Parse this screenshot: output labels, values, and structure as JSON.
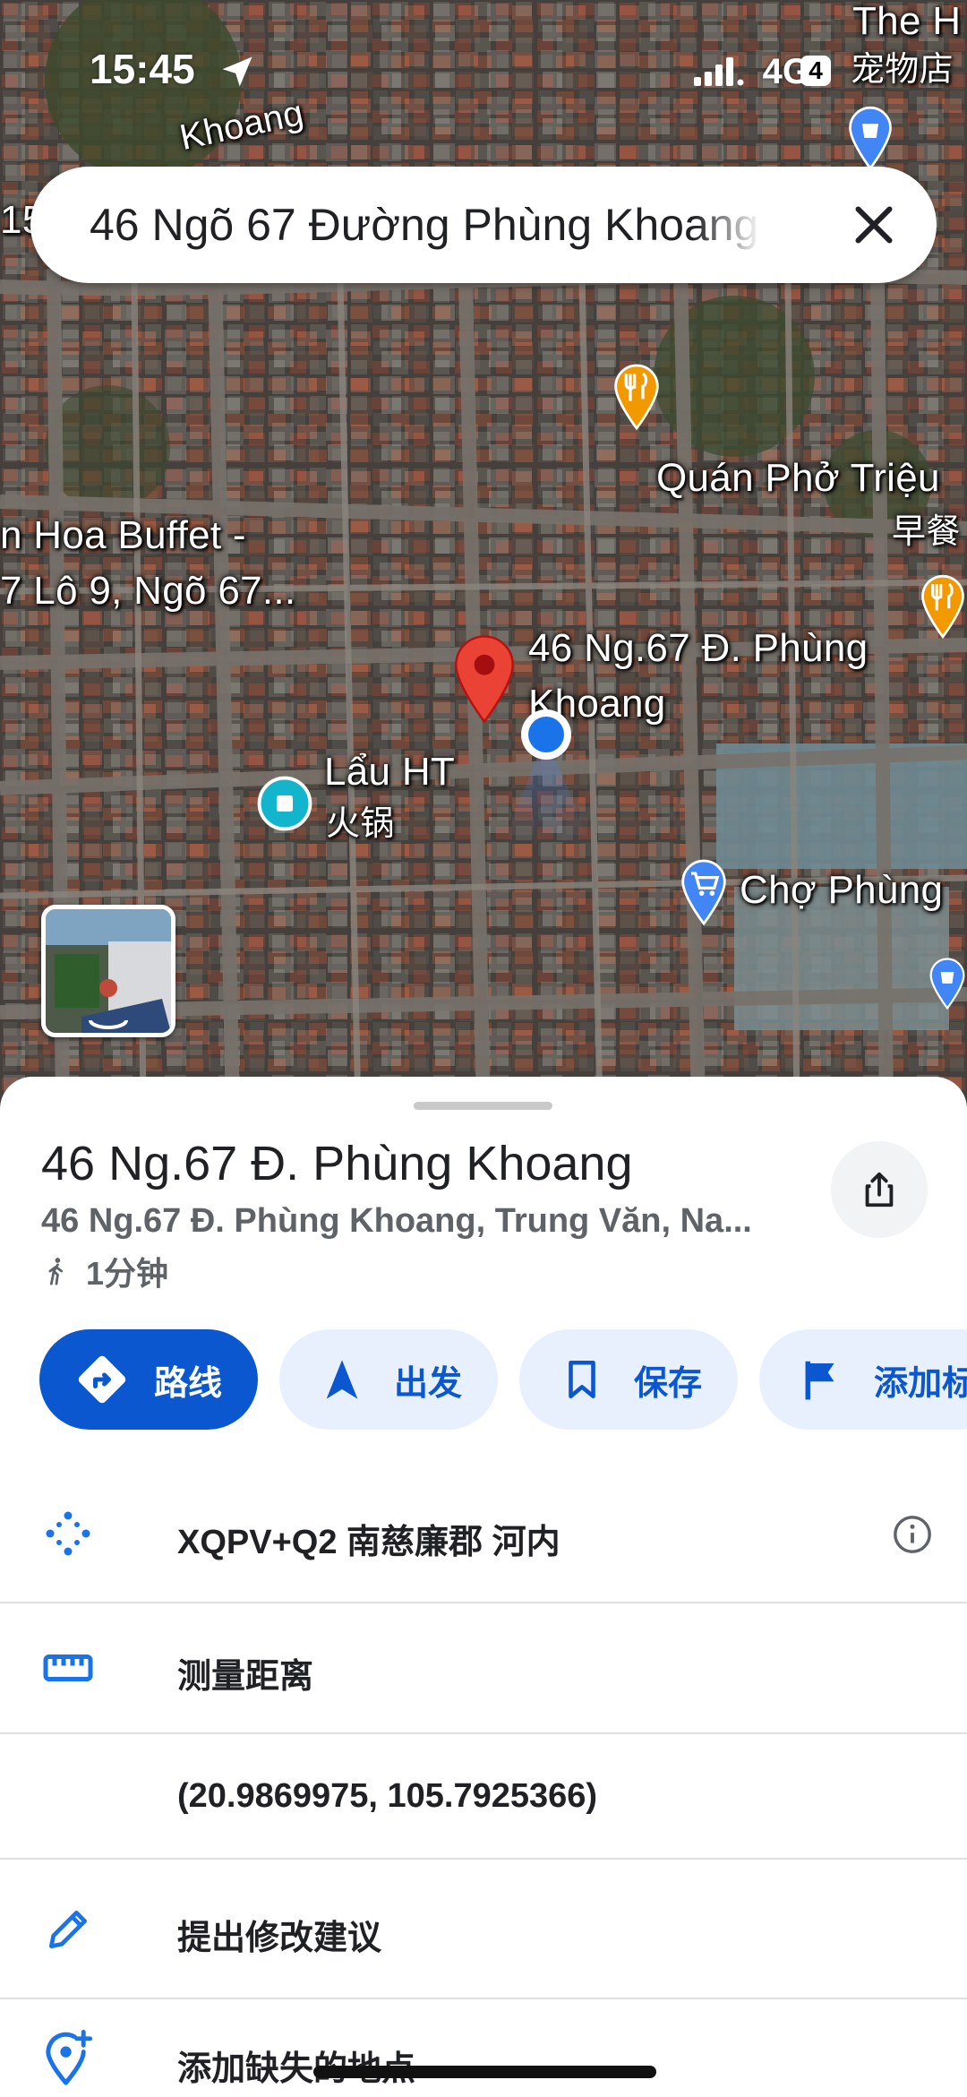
{
  "status_bar": {
    "time": "15:45",
    "network": "4G",
    "battery": "4"
  },
  "search": {
    "value": "46 Ngõ 67 Đường Phùng Khoang"
  },
  "map": {
    "labels": {
      "top_road": "Khoang",
      "top_left": "15",
      "top_right_1": "The H",
      "top_right_2": "宠物店",
      "restaurant": "Quán Phở Triệu",
      "restaurant_sub": "早餐",
      "buffet_1": "n Hoa Buffet -",
      "buffet_2": "7 Lô 9, Ngõ 67...",
      "selected_1": "46 Ng.67 Đ. Phùng",
      "selected_2": "Khoang",
      "hotpot": "Lẩu HT",
      "hotpot_sub": "火锅",
      "market": "Chợ Phùng"
    },
    "colors": {
      "pin_red": "#ea4335",
      "location_blue": "#1a73e8",
      "poi_orange": "#f29900",
      "poi_teal": "#12b5cb",
      "shop_blue": "#4285f4"
    }
  },
  "place": {
    "title": "46 Ng.67 Đ. Phùng Khoang",
    "address": "46 Ng.67 Đ. Phùng Khoang, Trung Văn, Na...",
    "walk_time": "1分钟"
  },
  "actions": [
    {
      "label": "路线",
      "icon": "directions-icon"
    },
    {
      "label": "出发",
      "icon": "navigation-arrow-icon"
    },
    {
      "label": "保存",
      "icon": "bookmark-icon"
    },
    {
      "label": "添加标",
      "icon": "flag-icon"
    }
  ],
  "details": {
    "plus_code": "XQPV+Q2 南慈廉郡 河内",
    "measure": "测量距离",
    "coordinates": "(20.9869975, 105.7925366)",
    "suggest_edit": "提出修改建议",
    "add_missing": "添加缺失的地点"
  }
}
